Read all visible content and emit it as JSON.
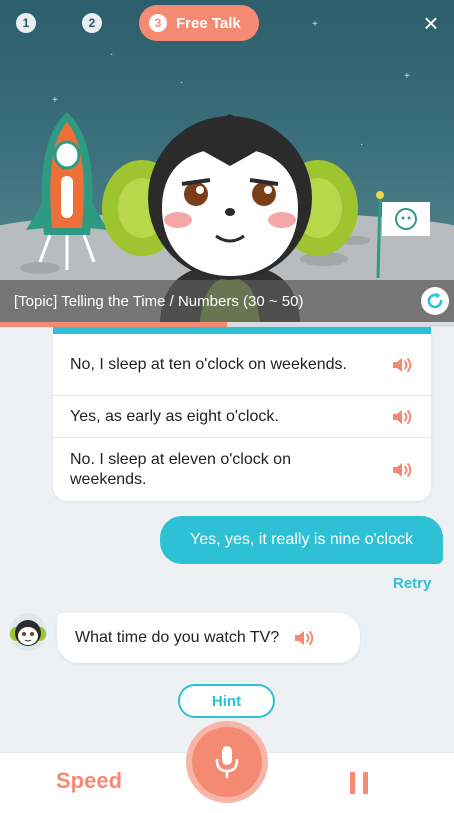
{
  "steps": {
    "step1": "1",
    "step2": "2",
    "step3_number": "3",
    "step3_label": "Free Talk"
  },
  "header": {
    "close_icon": "×"
  },
  "topic": {
    "text": "[Topic] Telling the Time / Numbers (30 ~ 50)"
  },
  "progress": {
    "fraction": 0.5
  },
  "options": [
    {
      "text": "No, I sleep at ten o'clock on weekends."
    },
    {
      "text": "Yes, as early as eight o'clock."
    },
    {
      "text": "No. I sleep at eleven o'clock on weekends."
    }
  ],
  "user_message": {
    "text": "Yes, yes, it really is nine o'clock",
    "retry_label": "Retry"
  },
  "bot_message": {
    "text": "What time do you watch TV?"
  },
  "hint": {
    "label": "Hint"
  },
  "bottom": {
    "speed_label": "Speed"
  },
  "colors": {
    "accent_coral": "#f58a72",
    "accent_cyan": "#2ec1d6"
  }
}
